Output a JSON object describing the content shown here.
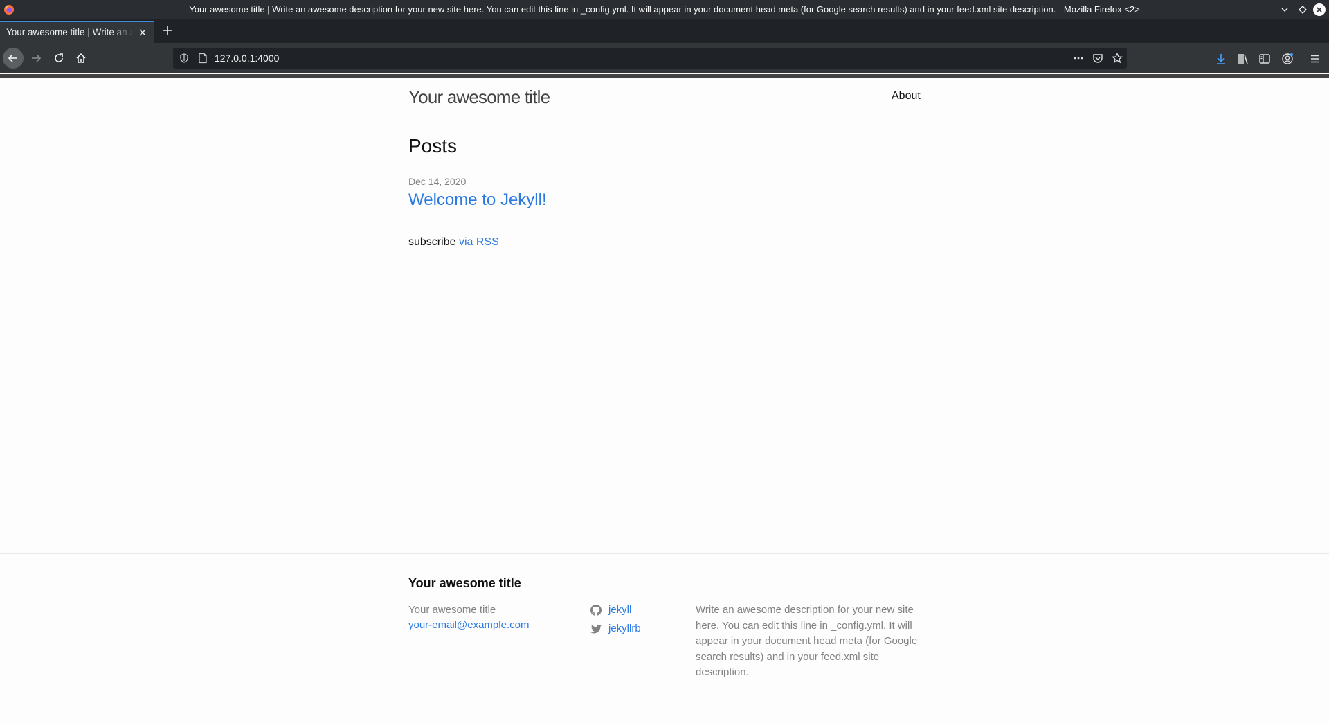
{
  "window": {
    "title": "Your awesome title | Write an awesome description for your new site here. You can edit this line in _config.yml. It will appear in your document head meta (for Google search results) and in your feed.xml site description. - Mozilla Firefox <2>"
  },
  "tabs": [
    {
      "label": "Your awesome title | Write an awesome description",
      "active": true
    }
  ],
  "toolbar": {
    "url": "127.0.0.1:4000"
  },
  "site": {
    "title": "Your awesome title",
    "nav": [
      "About"
    ]
  },
  "main": {
    "heading": "Posts",
    "posts": [
      {
        "date": "Dec 14, 2020",
        "title": "Welcome to Jekyll!"
      }
    ],
    "subscribe_text": "subscribe",
    "subscribe_link": "via RSS"
  },
  "footer": {
    "heading": "Your awesome title",
    "name": "Your awesome title",
    "email": "your-email@example.com",
    "social": [
      {
        "icon": "github-icon",
        "label": "jekyll"
      },
      {
        "icon": "twitter-icon",
        "label": "jekyllrb"
      }
    ],
    "description": "Write an awesome description for your new site here. You can edit this line in _config.yml. It will appear in your document head meta (for Google search results) and in your feed.xml site description."
  },
  "colors": {
    "link": "#2a7ae2",
    "text": "#111111",
    "muted": "#828282",
    "chrome_dark": "#2a2e32",
    "tab_accent": "#3d8bd8",
    "download_accent": "#45a1ff"
  }
}
